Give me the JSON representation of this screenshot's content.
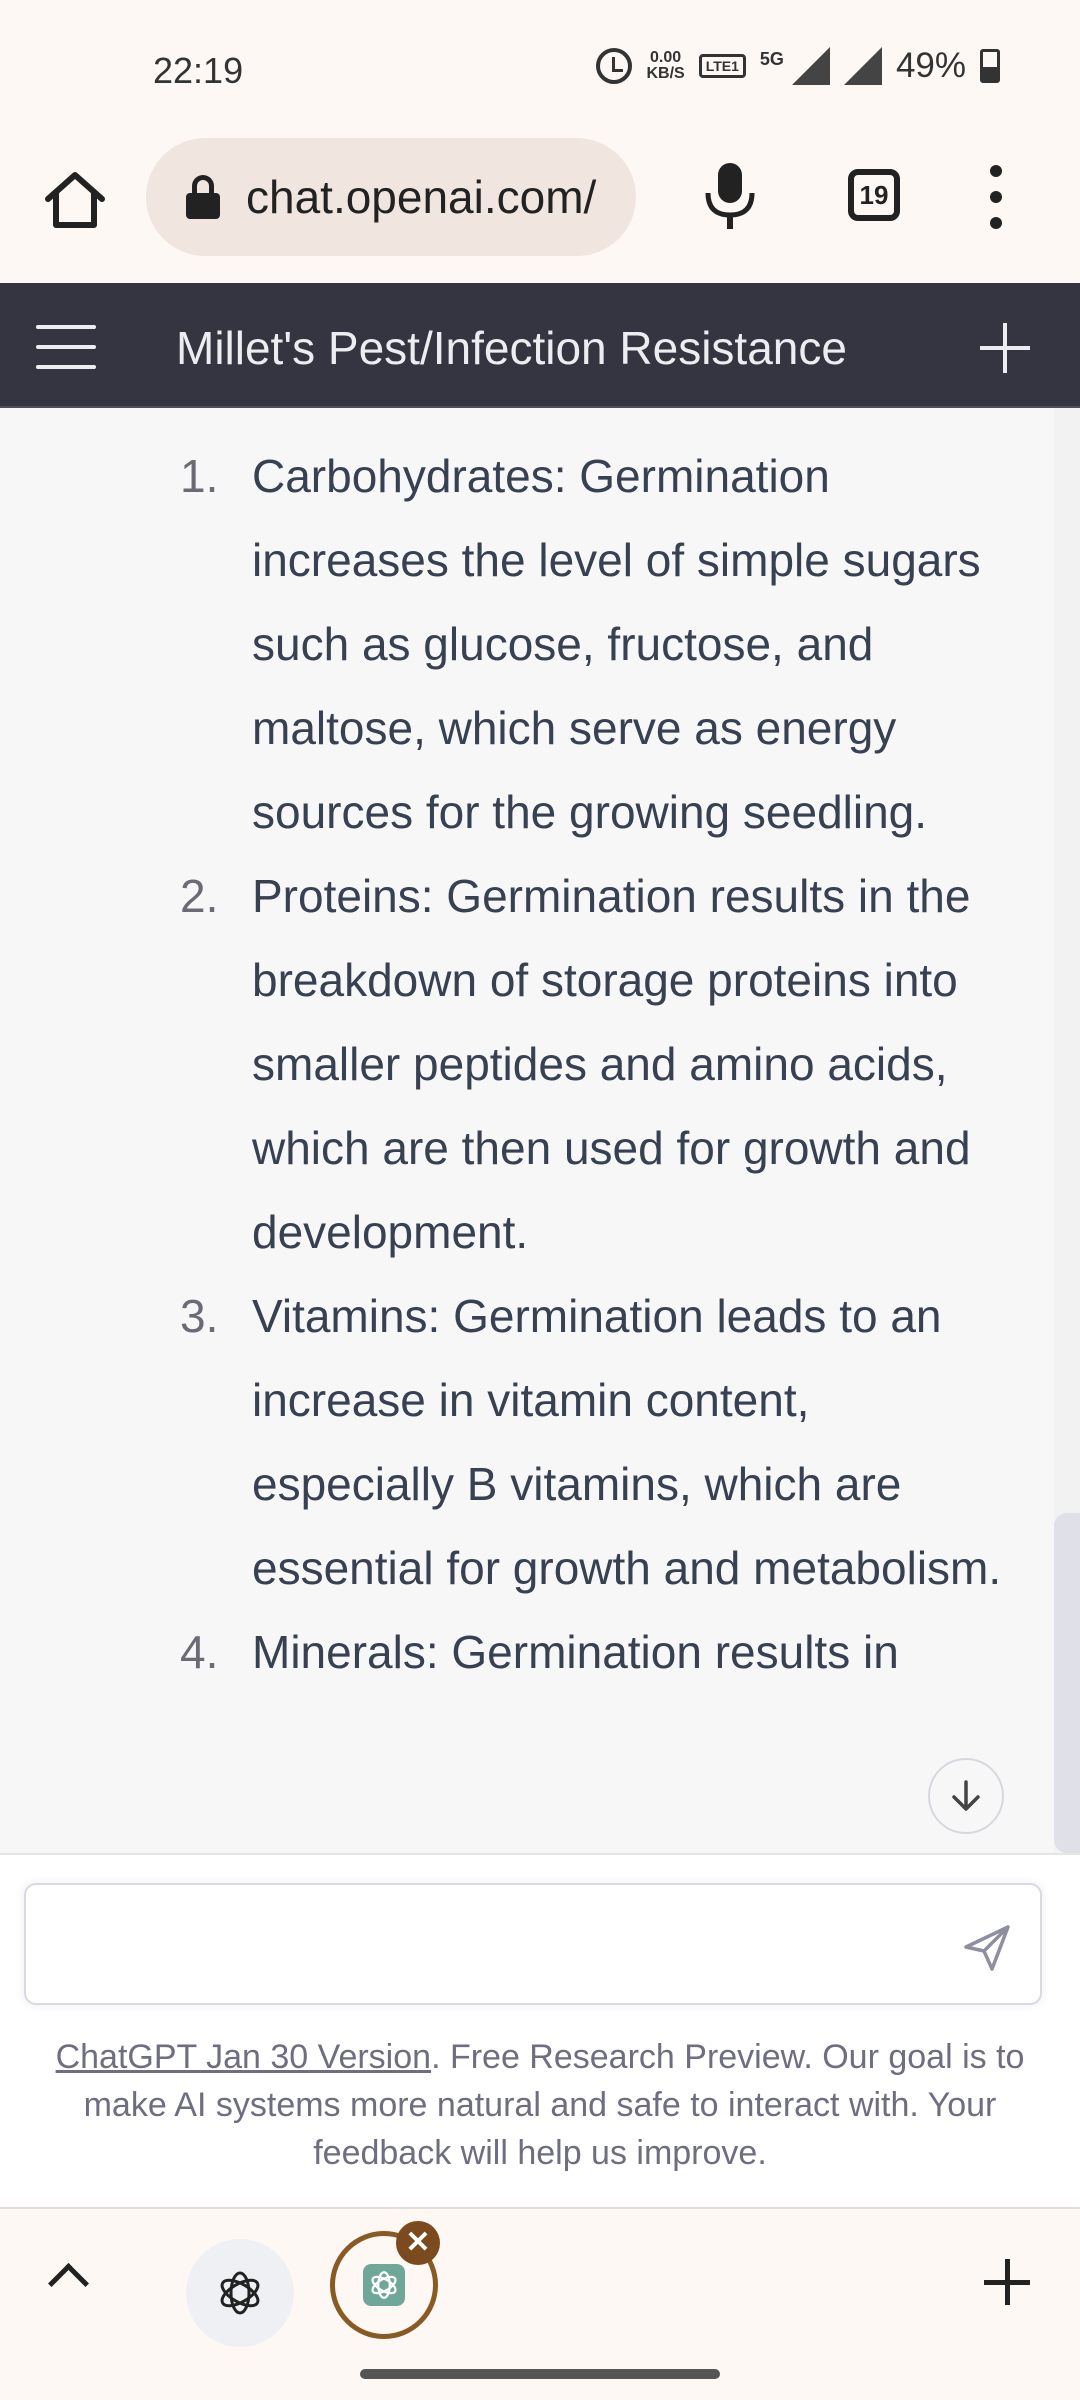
{
  "status_bar": {
    "time": "22:19",
    "net_speed_top": "0.00",
    "net_speed_unit": "KB/S",
    "volte_label": "LTE1",
    "network_type": "5G",
    "battery_percent": "49%"
  },
  "browser": {
    "url": "chat.openai.com/",
    "tab_count": "19"
  },
  "chat_header": {
    "title": "Millet's Pest/Infection Resistance"
  },
  "content": {
    "list_items": [
      {
        "number": "1.",
        "text": "Carbohydrates: Germination increases the level of simple sugars such as glucose, fructose, and maltose, which serve as energy sources for the growing seedling."
      },
      {
        "number": "2.",
        "text": "Proteins: Germination results in the breakdown of storage proteins into smaller peptides and amino acids, which are then used for growth and development."
      },
      {
        "number": "3.",
        "text": "Vitamins: Germination leads to an increase in vitamin content, especially B vitamins, which are essential for growth and metabolism."
      },
      {
        "number": "4.",
        "text": "Minerals: Germination results in"
      }
    ]
  },
  "input": {
    "placeholder": "",
    "disclaimer_link": "ChatGPT Jan 30 Version",
    "disclaimer_text": ". Free Research Preview. Our goal is to make AI systems more natural and safe to interact with. Your feedback will help us improve."
  },
  "icons": {
    "home": "home-icon",
    "lock": "lock-icon",
    "mic": "microphone-icon",
    "menu": "more-vert-icon",
    "hamburger": "hamburger-icon",
    "new_chat": "plus-icon",
    "scroll_down": "arrow-down-icon",
    "send": "send-icon",
    "tab_close": "close-icon"
  },
  "colors": {
    "header_bg": "#343541",
    "content_bg": "#f7f7f8",
    "tab_accent": "#8a5a24"
  }
}
